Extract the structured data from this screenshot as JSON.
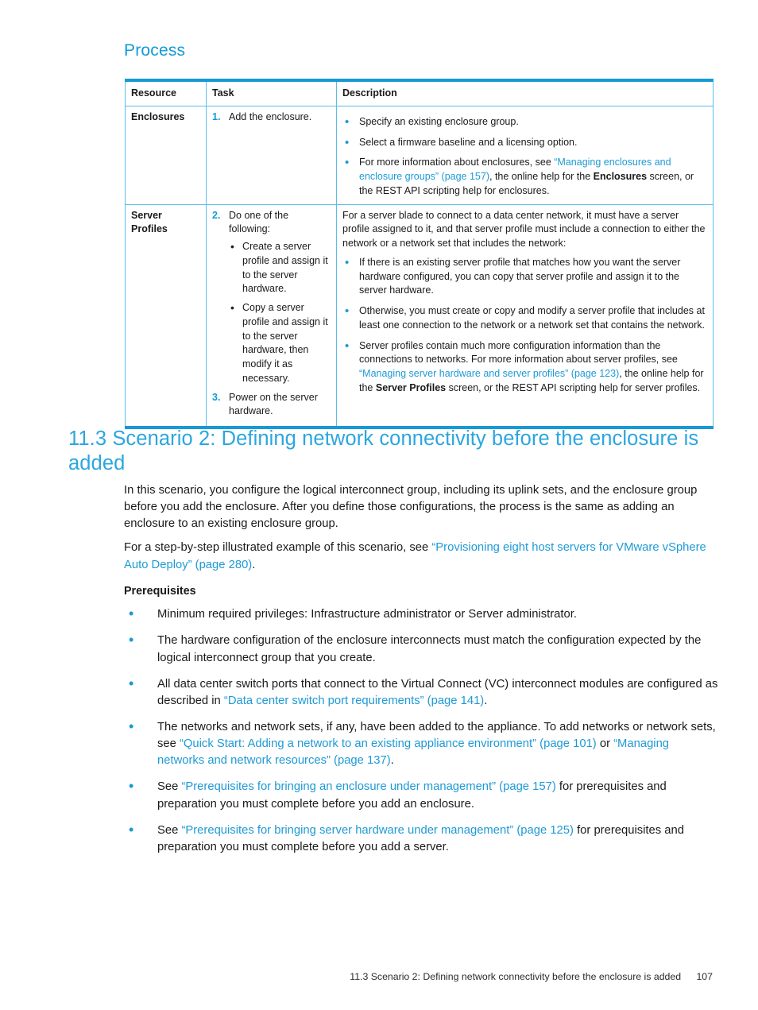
{
  "page": {
    "process_heading": "Process",
    "footer_text": "11.3 Scenario 2: Defining network connectivity before the enclosure is added",
    "footer_page_number": "107",
    "accent_blue": "#1799d6",
    "link_blue": "#1e9ad6",
    "heading_blue": "#2ba6e0"
  },
  "table": {
    "headers": {
      "resource": "Resource",
      "task": "Task",
      "description": "Description"
    },
    "rows": [
      {
        "resource": "Enclosures",
        "steps": [
          {
            "num": "1.",
            "text": "Add the enclosure."
          }
        ],
        "description_bullets": [
          {
            "parts": [
              {
                "t": "Specify an existing enclosure group.",
                "s": "n"
              }
            ]
          },
          {
            "parts": [
              {
                "t": "Select a firmware baseline and a licensing option.",
                "s": "n"
              }
            ]
          },
          {
            "parts": [
              {
                "t": "For more information about enclosures, see ",
                "s": "n"
              },
              {
                "t": "“Managing enclosures and enclosure groups” (page 157)",
                "s": "link"
              },
              {
                "t": ", the online help for the ",
                "s": "n"
              },
              {
                "t": "Enclosures",
                "s": "b"
              },
              {
                "t": " screen, or the REST API scripting help for enclosures.",
                "s": "n"
              }
            ]
          }
        ]
      },
      {
        "resource": "Server Profiles",
        "steps": [
          {
            "num": "2.",
            "text": "Do one of the following:",
            "sub": [
              "Create a server profile and assign it to the server hardware.",
              "Copy a server profile and assign it to the server hardware, then modify it as necessary."
            ]
          },
          {
            "num": "3.",
            "text": "Power on the server hardware."
          }
        ],
        "description_intro": "For a server blade to connect to a data center network, it must have a server profile assigned to it, and that server profile must include a connection to either the network or a network set that includes the network:",
        "description_bullets": [
          {
            "parts": [
              {
                "t": "If there is an existing server profile that matches how you want the server hardware configured, you can copy that server profile and assign it to the server hardware.",
                "s": "n"
              }
            ]
          },
          {
            "parts": [
              {
                "t": "Otherwise, you must create or copy and modify a server profile that includes at least one connection to the network or a network set that contains the network.",
                "s": "n"
              }
            ]
          },
          {
            "parts": [
              {
                "t": "Server profiles contain much more configuration information than the connections to networks. For more information about server profiles, see ",
                "s": "n"
              },
              {
                "t": "“Managing server hardware and server profiles” (page 123)",
                "s": "link"
              },
              {
                "t": ", the online help for the ",
                "s": "n"
              },
              {
                "t": "Server Profiles",
                "s": "b"
              },
              {
                "t": " screen, or the REST API scripting help for server profiles.",
                "s": "n"
              }
            ]
          }
        ]
      }
    ]
  },
  "section": {
    "heading": "11.3 Scenario 2: Defining network connectivity before the enclosure is added",
    "paragraphs": [
      {
        "parts": [
          {
            "t": "In this scenario, you configure the logical interconnect group, including its uplink sets, and the enclosure group before you add the enclosure. After you define those configurations, the process is the same as adding an enclosure to an existing enclosure group.",
            "s": "n"
          }
        ]
      },
      {
        "parts": [
          {
            "t": "For a step-by-step illustrated example of this scenario, see ",
            "s": "n"
          },
          {
            "t": "“Provisioning eight host servers for VMware vSphere Auto Deploy” (page 280)",
            "s": "link"
          },
          {
            "t": ".",
            "s": "n"
          }
        ]
      }
    ],
    "prerequisites_heading": "Prerequisites",
    "prerequisites": [
      {
        "parts": [
          {
            "t": "Minimum required privileges: Infrastructure administrator or Server administrator.",
            "s": "n"
          }
        ]
      },
      {
        "parts": [
          {
            "t": "The hardware configuration of the enclosure interconnects must match the configuration expected by the logical interconnect group that you create.",
            "s": "n"
          }
        ]
      },
      {
        "parts": [
          {
            "t": "All data center switch ports that connect to the Virtual Connect (VC) interconnect modules are configured as described in ",
            "s": "n"
          },
          {
            "t": "“Data center switch port requirements” (page 141)",
            "s": "link"
          },
          {
            "t": ".",
            "s": "n"
          }
        ]
      },
      {
        "parts": [
          {
            "t": "The networks and network sets, if any, have been added to the appliance. To add networks or network sets, see ",
            "s": "n"
          },
          {
            "t": "“Quick Start: Adding a network to an existing appliance environment” (page 101)",
            "s": "link"
          },
          {
            "t": " or ",
            "s": "n"
          },
          {
            "t": "“Managing networks and network resources” (page 137)",
            "s": "link"
          },
          {
            "t": ".",
            "s": "n"
          }
        ]
      },
      {
        "parts": [
          {
            "t": "See ",
            "s": "n"
          },
          {
            "t": "“Prerequisites for bringing an enclosure under management” (page 157)",
            "s": "link"
          },
          {
            "t": " for prerequisites and preparation you must complete before you add an enclosure.",
            "s": "n"
          }
        ]
      },
      {
        "parts": [
          {
            "t": "See ",
            "s": "n"
          },
          {
            "t": "“Prerequisites for bringing server hardware under management” (page 125)",
            "s": "link"
          },
          {
            "t": " for prerequisites and preparation you must complete before you add a server.",
            "s": "n"
          }
        ]
      }
    ]
  }
}
